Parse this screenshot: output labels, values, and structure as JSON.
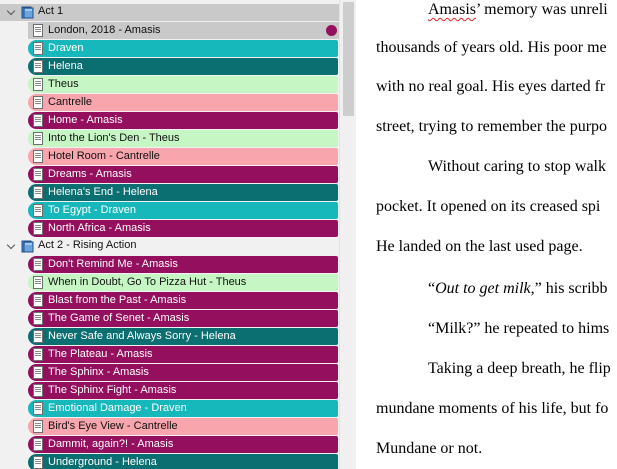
{
  "colors": {
    "Amasis": "#940f5d",
    "Draven": "#16b8bc",
    "Helena": "#0b6e70",
    "Theus": "#c6f6c4",
    "Cantrelle": "#f8a5ad",
    "selected": "#c9c9c9",
    "binder_bg": "#f1f1f1"
  },
  "binder": {
    "groups": [
      {
        "label": "Act 1",
        "icon": "book-icon",
        "expanded": true,
        "selected": true,
        "items": [
          {
            "label": "London, 2018 - Amasis",
            "pov": "Amasis",
            "selected": true
          },
          {
            "label": "Draven",
            "pov": "Draven"
          },
          {
            "label": "Helena",
            "pov": "Helena"
          },
          {
            "label": "Theus",
            "pov": "Theus"
          },
          {
            "label": "Cantrelle",
            "pov": "Cantrelle"
          },
          {
            "label": "Home - Amasis",
            "pov": "Amasis"
          },
          {
            "label": "Into the Lion's Den  - Theus",
            "pov": "Theus"
          },
          {
            "label": "Hotel Room - Cantrelle",
            "pov": "Cantrelle"
          },
          {
            "label": "Dreams - Amasis",
            "pov": "Amasis"
          },
          {
            "label": "Helena's End - Helena",
            "pov": "Helena"
          },
          {
            "label": "To Egypt - Draven",
            "pov": "Draven"
          },
          {
            "label": "North Africa - Amasis",
            "pov": "Amasis"
          }
        ]
      },
      {
        "label": "Act 2 - Rising Action",
        "icon": "book-icon",
        "expanded": true,
        "items": [
          {
            "label": "Don't Remind Me - Amasis",
            "pov": "Amasis"
          },
          {
            "label": "When in Doubt, Go To Pizza Hut - Theus",
            "pov": "Theus"
          },
          {
            "label": "Blast from the Past - Amasis",
            "pov": "Amasis"
          },
          {
            "label": "The Game of Senet - Amasis",
            "pov": "Amasis"
          },
          {
            "label": "Never Safe and Always Sorry - Helena",
            "pov": "Helena"
          },
          {
            "label": "The Plateau - Amasis",
            "pov": "Amasis"
          },
          {
            "label": "The Sphinx - Amasis",
            "pov": "Amasis"
          },
          {
            "label": "The Sphinx Fight - Amasis",
            "pov": "Amasis"
          },
          {
            "label": "Emotional Damage - Draven",
            "pov": "Draven"
          },
          {
            "label": "Bird's Eye View - Cantrelle",
            "pov": "Cantrelle"
          },
          {
            "label": "Dammit, again?! - Amasis",
            "pov": "Amasis"
          },
          {
            "label": "Underground - Helena",
            "pov": "Helena"
          }
        ]
      }
    ]
  },
  "editor": {
    "lines": [
      {
        "segments": [
          {
            "text": "Amasis",
            "spellcheck": true
          },
          {
            "text": "’ memory was unreli"
          }
        ],
        "indent": true
      },
      {
        "segments": [
          {
            "text": "thousands of years old. His poor me"
          }
        ]
      },
      {
        "segments": [
          {
            "text": "with no real goal. His eyes darted fr"
          }
        ]
      },
      {
        "segments": [
          {
            "text": "street, trying to remember the purpo"
          }
        ]
      },
      {
        "segments": [
          {
            "text": "Without caring to stop walk"
          }
        ],
        "indent": true
      },
      {
        "segments": [
          {
            "text": "pocket. It opened on its creased spi"
          }
        ]
      },
      {
        "segments": [
          {
            "text": "He landed on the last used page."
          }
        ]
      },
      {
        "segments": [
          {
            "text": "“"
          },
          {
            "text": "Out to get milk,",
            "italic": true
          },
          {
            "text": "” his scribb"
          }
        ],
        "indent": true
      },
      {
        "segments": [
          {
            "text": "“Milk?” he repeated to hims"
          }
        ],
        "indent": true
      },
      {
        "segments": [
          {
            "text": "Taking a deep breath, he flip"
          }
        ],
        "indent": true
      },
      {
        "segments": [
          {
            "text": "mundane moments of his life, but fo"
          }
        ]
      },
      {
        "segments": [
          {
            "text": "Mundane or not."
          }
        ]
      }
    ]
  }
}
